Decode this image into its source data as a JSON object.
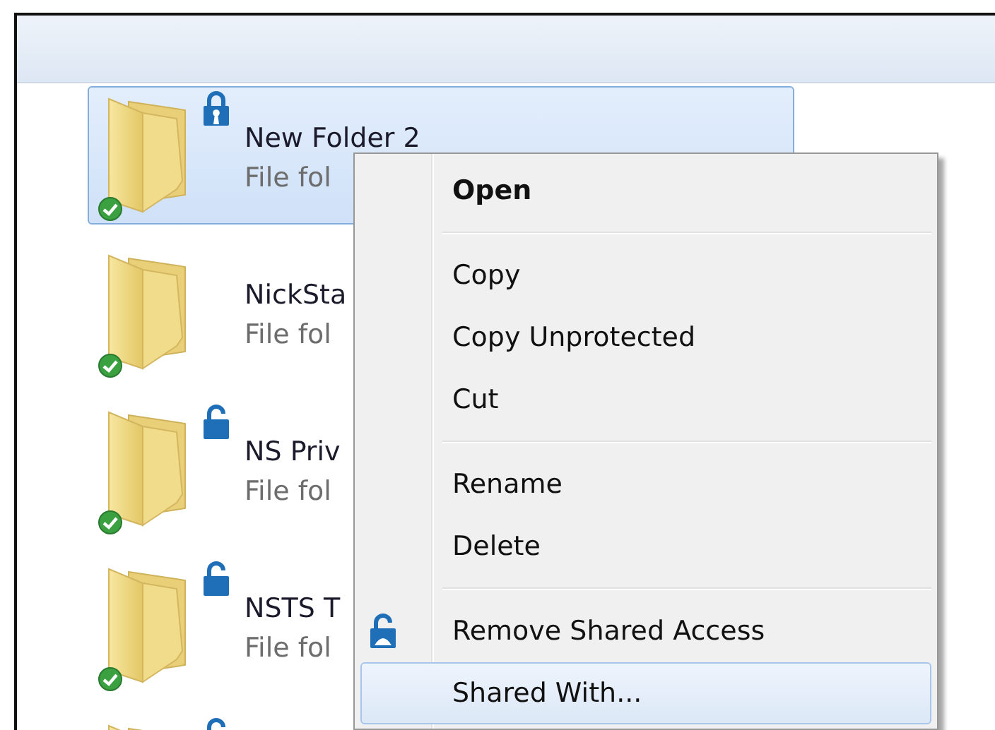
{
  "files": [
    {
      "kind": "locked",
      "name": "New Folder 2",
      "type": "File fol",
      "selected": true
    },
    {
      "kind": "plain",
      "name": "NickSta",
      "type": "File fol",
      "selected": false
    },
    {
      "kind": "shared",
      "name": "NS Priv",
      "type": "File fol",
      "selected": false
    },
    {
      "kind": "shared",
      "name": "NSTS T",
      "type": "File fol",
      "selected": false
    },
    {
      "kind": "shared",
      "selected": false
    }
  ],
  "context_menu": {
    "items": [
      {
        "kind": "item",
        "label": "Open",
        "default": true,
        "selected": false
      },
      {
        "kind": "separator"
      },
      {
        "kind": "item",
        "label": "Copy",
        "default": false,
        "selected": false
      },
      {
        "kind": "item",
        "label": "Copy Unprotected",
        "default": false,
        "selected": false
      },
      {
        "kind": "item",
        "label": "Cut",
        "default": false,
        "selected": false
      },
      {
        "kind": "separator"
      },
      {
        "kind": "item",
        "label": "Rename",
        "default": false,
        "selected": false
      },
      {
        "kind": "item",
        "label": "Delete",
        "default": false,
        "selected": false
      },
      {
        "kind": "separator"
      },
      {
        "kind": "iconitem",
        "label": "Remove Shared Access",
        "default": false,
        "selected": false
      },
      {
        "kind": "item",
        "label": "Shared With...",
        "default": false,
        "selected": true
      }
    ]
  }
}
